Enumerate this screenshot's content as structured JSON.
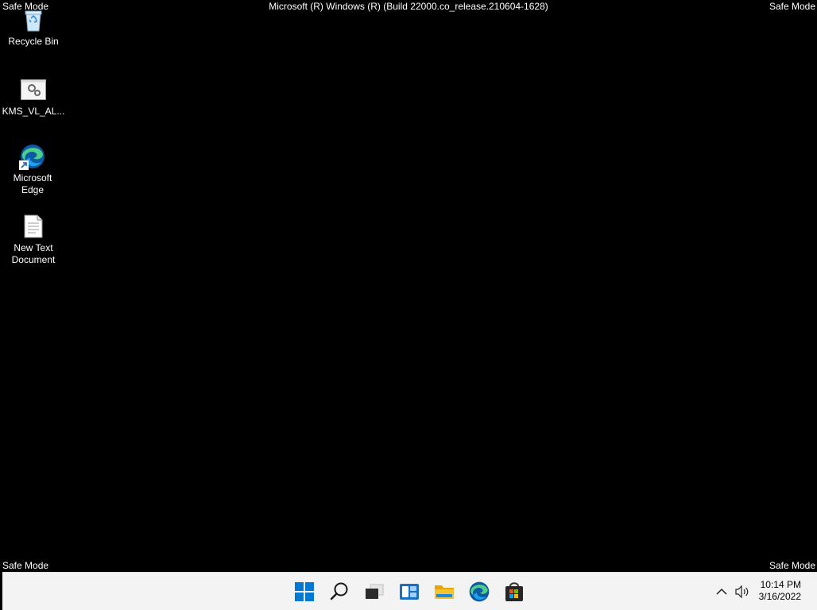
{
  "overlay": {
    "safe_mode_tl": "Safe Mode",
    "safe_mode_tr": "Safe Mode",
    "safe_mode_bl": "Safe Mode",
    "safe_mode_br": "Safe Mode",
    "build_text": "Microsoft (R) Windows (R) (Build 22000.co_release.210604-1628)"
  },
  "desktop_icons": [
    {
      "label": "Recycle Bin",
      "icon": "recycle-bin-icon"
    },
    {
      "label": "KMS_VL_AL...",
      "icon": "settings-file-icon"
    },
    {
      "label": "Microsoft Edge",
      "icon": "edge-icon"
    },
    {
      "label": "New Text Document",
      "icon": "text-document-icon"
    }
  ],
  "taskbar": {
    "buttons": [
      "start",
      "search",
      "task-view",
      "widgets",
      "file-explorer",
      "edge",
      "store"
    ],
    "clock": {
      "time": "10:14 PM",
      "date": "3/16/2022"
    },
    "tray": [
      "show-hidden-icons",
      "volume"
    ]
  },
  "colors": {
    "desktop_bg": "#000000",
    "taskbar_bg": "#f3f3f3",
    "windows_blue": "#0078d4",
    "folder_yellow": "#f4b400"
  }
}
